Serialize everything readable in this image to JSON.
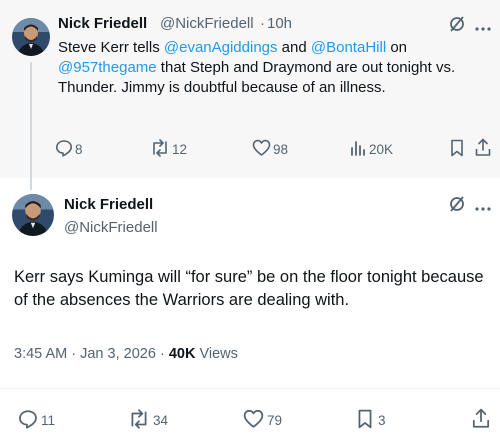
{
  "colors": {
    "accent": "#1d9bf0",
    "muted": "#536471",
    "text": "#0f1419",
    "quoted_bg": "#f7f7f7"
  },
  "first_tweet": {
    "author": "Nick Friedell",
    "handle": "@NickFriedell",
    "separator": "·",
    "time": "10h",
    "text": {
      "p1": "Steve Kerr tells ",
      "m1": "@evanAgiddings",
      "p2": " and ",
      "m2": "@BontaHill",
      "p3": " on ",
      "m3": "@957thegame",
      "p4": " that Steph and Draymond are out tonight vs. Thunder. Jimmy is doubtful because of an illness."
    },
    "actions": {
      "replies": "8",
      "reposts": "12",
      "likes": "98",
      "views": "20K"
    }
  },
  "main_tweet": {
    "author": "Nick Friedell",
    "handle": "@NickFriedell",
    "text": "Kerr says Kuminga will “for sure” be on the floor tonight because of the absences the Warriors are dealing with.",
    "time": "3:45 AM",
    "separator": "·",
    "date": "Jan 3, 2026",
    "views_count": "40K",
    "views_label": "Views",
    "actions": {
      "replies": "11",
      "reposts": "34",
      "likes": "79",
      "bookmarks": "3"
    }
  },
  "icons": {
    "grok": "grok-icon",
    "more": "more-icon",
    "reply": "reply-icon",
    "repost": "repost-icon",
    "like": "like-icon",
    "views": "views-icon",
    "bookmark": "bookmark-icon",
    "share": "share-icon"
  }
}
